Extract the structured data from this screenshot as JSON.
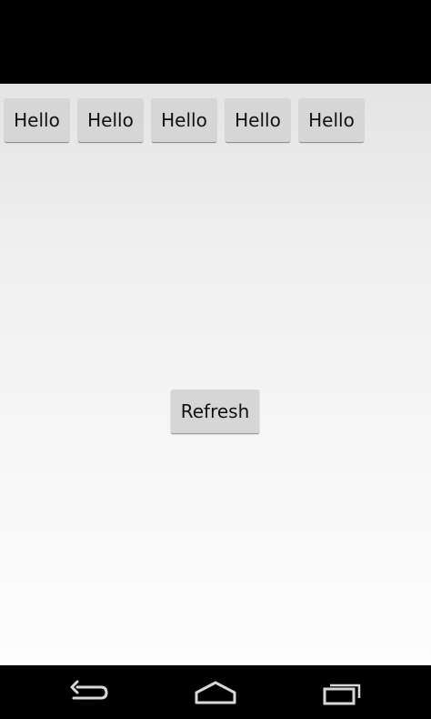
{
  "buttons_row": [
    {
      "label": "Hello"
    },
    {
      "label": "Hello"
    },
    {
      "label": "Hello"
    },
    {
      "label": "Hello"
    },
    {
      "label": "Hello"
    }
  ],
  "refresh_button": {
    "label": "Refresh"
  },
  "navigation_bar": {
    "back_icon": "back-icon",
    "home_icon": "home-icon",
    "recents_icon": "recent-apps-icon"
  },
  "colors": {
    "button_bg": "#d6d6d6",
    "nav_icon": "#d8d8d8",
    "bars": "#000000"
  }
}
